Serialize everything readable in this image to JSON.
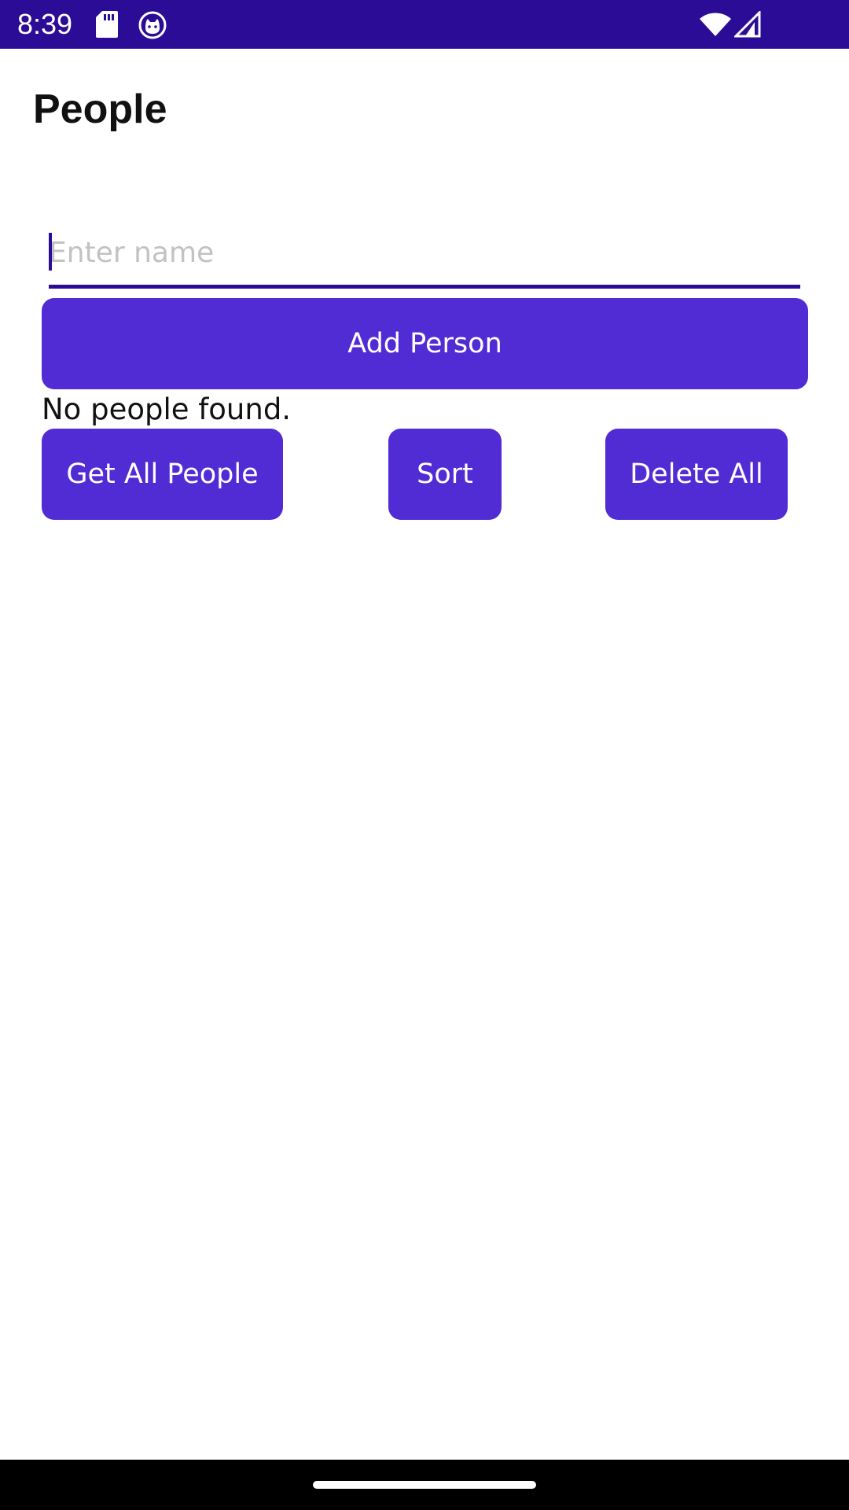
{
  "status_bar": {
    "time": "8:39",
    "icons": [
      "sd-card-icon",
      "cat-face-icon",
      "wifi-icon",
      "cell-signal-icon"
    ]
  },
  "page": {
    "title": "People"
  },
  "form": {
    "name_placeholder": "Enter name",
    "name_value": "",
    "add_label": "Add Person"
  },
  "status_message": "No people found.",
  "actions": {
    "get_all_label": "Get All People",
    "sort_label": "Sort",
    "delete_all_label": "Delete All"
  },
  "colors": {
    "status_bar": "#2b0c96",
    "accent": "#512bd4",
    "input_underline": "#2b0c96"
  }
}
